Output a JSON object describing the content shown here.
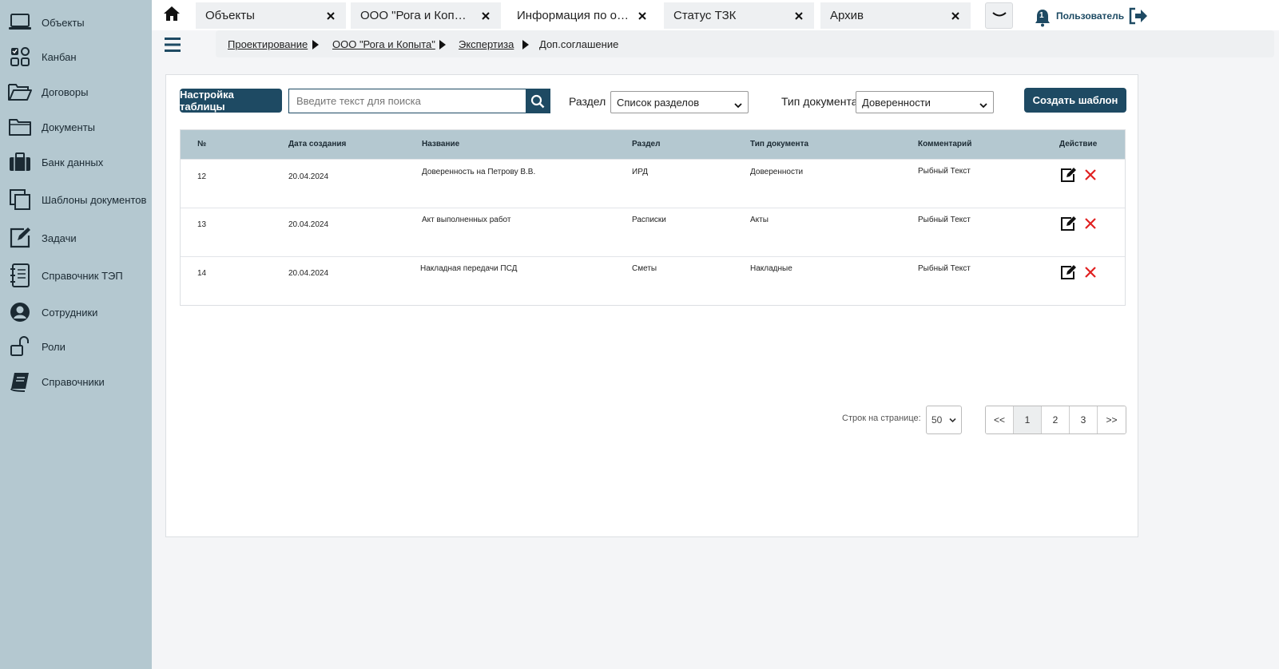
{
  "sidebar": {
    "items": [
      {
        "label": "Объекты",
        "icon": "laptop-icon"
      },
      {
        "label": "Канбан",
        "icon": "kanban-icon"
      },
      {
        "label": "Договоры",
        "icon": "folder-open-icon"
      },
      {
        "label": "Документы",
        "icon": "folder-icon"
      },
      {
        "label": "Банк данных",
        "icon": "briefcase-icon"
      },
      {
        "label": "Шаблоны документов",
        "icon": "copy-icon"
      },
      {
        "label": "Задачи",
        "icon": "edit-square-icon"
      },
      {
        "label": "Справочник ТЭП",
        "icon": "notebook-list-icon"
      },
      {
        "label": "Сотрудники",
        "icon": "user-circle-icon"
      },
      {
        "label": "Роли",
        "icon": "unlock-icon"
      },
      {
        "label": "Справочники",
        "icon": "book-icon"
      }
    ]
  },
  "tabs": [
    {
      "label": "Объекты"
    },
    {
      "label": "ООО \"Рога и Копыта\""
    },
    {
      "label": "Информация по об..."
    },
    {
      "label": "Статус ТЗК"
    },
    {
      "label": "Архив"
    }
  ],
  "header": {
    "user_label": "Пользователь",
    "notification_count": "1"
  },
  "breadcrumb": [
    {
      "label": "Проектирование"
    },
    {
      "label": "ООО \"Рога и Копыта\""
    },
    {
      "label": "Экспертиза"
    },
    {
      "label": "Доп.соглашение"
    }
  ],
  "toolbar": {
    "table_settings_label": "Настройка таблицы",
    "search_placeholder": "Введите текст для поиска",
    "section_label": "Раздел",
    "section_value": "Список разделов",
    "doctype_label": "Тип документа",
    "doctype_value": "Доверенности",
    "create_template_label": "Создать шаблон"
  },
  "table": {
    "columns": [
      "№",
      "Дата создания",
      "Название",
      "Раздел",
      "Тип документа",
      "Комментарий",
      "Действие"
    ],
    "rows": [
      {
        "num": "12",
        "date": "20.04.2024",
        "name": "Доверенность на Петрову В.В.",
        "section": "ИРД",
        "doctype": "Доверенности",
        "comment": "Рыбный Текст"
      },
      {
        "num": "13",
        "date": "20.04.2024",
        "name": "Акт выполненных работ",
        "section": "Расписки",
        "doctype": "Акты",
        "comment": "Рыбный Текст"
      },
      {
        "num": "14",
        "date": "20.04.2024",
        "name": "Накладная передачи ПСД",
        "section": "Сметы",
        "doctype": "Накладные",
        "comment": "Рыбный Текст"
      }
    ]
  },
  "pagination": {
    "rows_label": "Строк на странице:",
    "rows_value": "50",
    "first": "<<",
    "pages": [
      "1",
      "2",
      "3"
    ],
    "last": ">>"
  },
  "colors": {
    "sidebar_bg": "#b4c8d0",
    "accent": "#1e4a63",
    "delete": "#e02020"
  }
}
